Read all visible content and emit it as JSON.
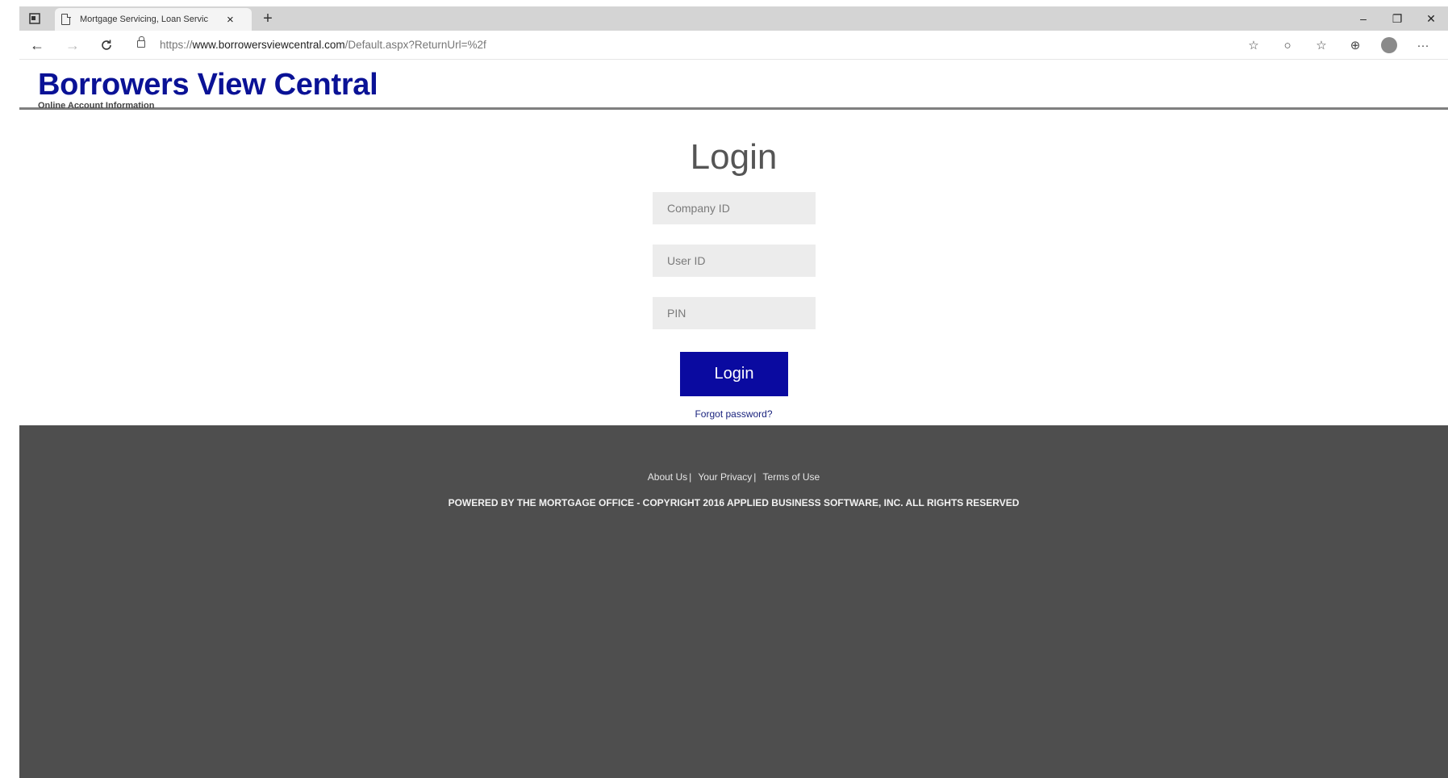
{
  "browser": {
    "tab_title": "Mortgage Servicing, Loan Servic",
    "tab_close": "×",
    "new_tab": "+",
    "url_scheme": "https://",
    "url_host": "www.borrowersviewcentral.com",
    "url_path": "/Default.aspx?ReturnUrl=%2f",
    "window_controls": {
      "minimize": "–",
      "restore": "❐",
      "close": "✕"
    },
    "nav": {
      "back": "←",
      "forward": "→",
      "reload": "C"
    },
    "toolbar": {
      "read_aloud": "☆",
      "circle": "○",
      "favorites": "☆",
      "collections": "⊕",
      "more": "···"
    }
  },
  "header": {
    "brand": "Borrowers View Central",
    "subtitle": "Online Account Information"
  },
  "login": {
    "title": "Login",
    "company_placeholder": "Company ID",
    "user_placeholder": "User ID",
    "pin_placeholder": "PIN",
    "button_label": "Login",
    "forgot_link": "Forgot password?"
  },
  "footer": {
    "about": "About Us",
    "privacy": "Your Privacy",
    "terms": "Terms of Use",
    "separator": "|",
    "copyright": "POWERED BY THE MORTGAGE OFFICE - COPYRIGHT 2016 APPLIED BUSINESS SOFTWARE, INC. ALL RIGHTS RESERVED"
  },
  "colors": {
    "brand": "#0a1296",
    "button": "#0a0aa0",
    "footer_bg": "#4e4e4e",
    "field_bg": "#ececec"
  }
}
